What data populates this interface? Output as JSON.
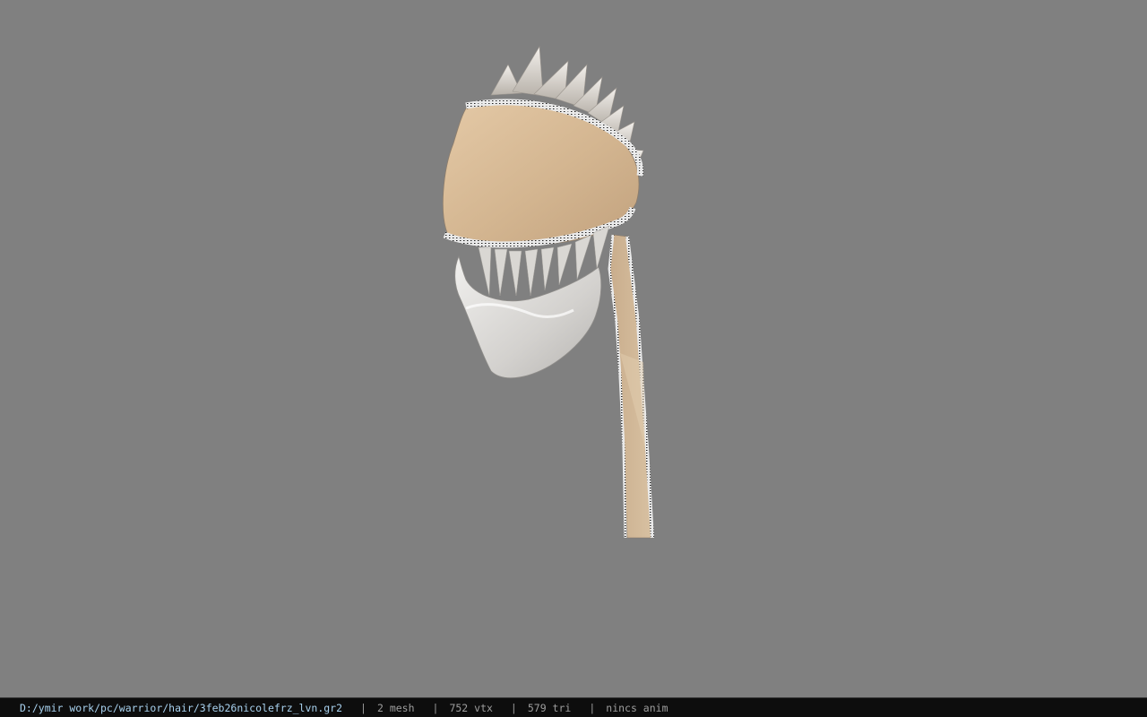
{
  "viewer": {
    "background_color": "#808080",
    "model_icon": "hair-mesh-3d-model"
  },
  "statusbar": {
    "file_path": "D:/ymir work/pc/warrior/hair/3feb26nicolefrz_lvn.gr2",
    "separator": "|",
    "mesh_count": "2 mesh",
    "vertex_count": "752 vtx",
    "triangle_count": "579 tri",
    "anim_info": "nincs anim"
  }
}
